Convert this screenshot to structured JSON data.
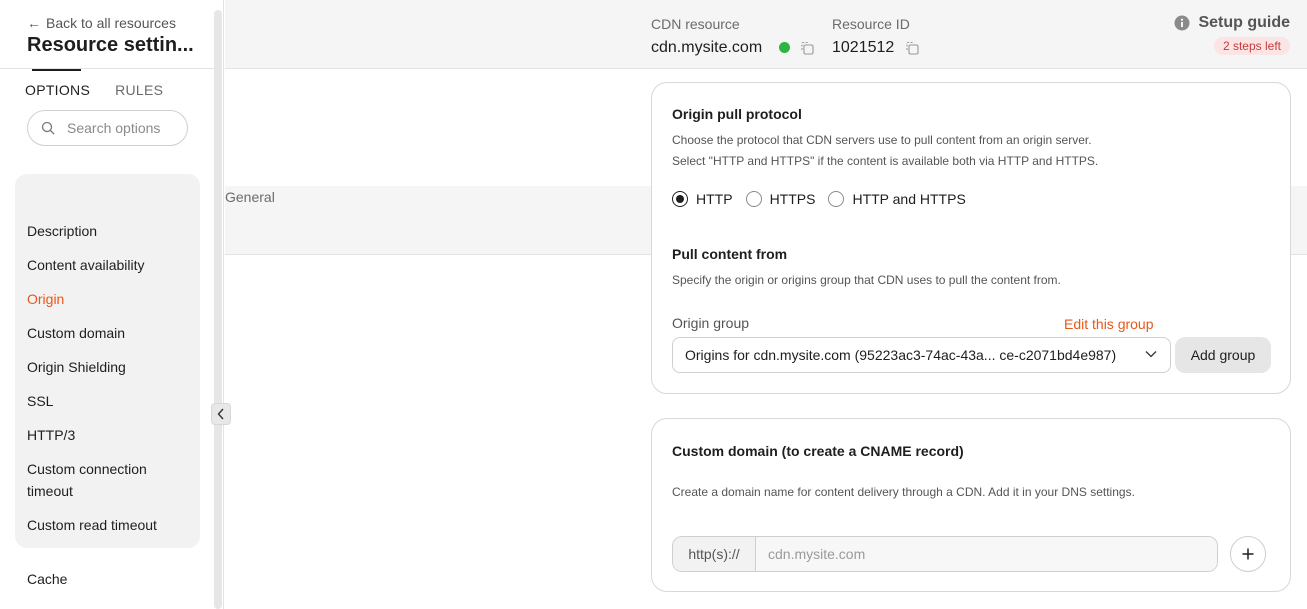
{
  "sidebar": {
    "back_label": "Back to all resources",
    "title": "Resource settin...",
    "tabs": [
      "OPTIONS",
      "RULES"
    ],
    "search_placeholder": "Search options",
    "group_header": "General",
    "items": [
      "Description",
      "Content availability",
      "Origin",
      "Custom domain",
      "Origin Shielding",
      "SSL",
      "HTTP/3",
      "Custom connection timeout",
      "Custom read timeout"
    ],
    "active_item": "Origin",
    "section_after": "Cache"
  },
  "header": {
    "cdn_label": "CDN resource",
    "cdn_value": "cdn.mysite.com",
    "id_label": "Resource ID",
    "id_value": "1021512",
    "guide_label": "Setup guide",
    "steps_badge": "2 steps left"
  },
  "origin_card": {
    "title": "Origin pull protocol",
    "desc1": "Choose the protocol that CDN servers use to pull content from an origin server.",
    "desc2": "Select \"HTTP and HTTPS\" if the content is available both via HTTP and HTTPS.",
    "protocols": [
      "HTTP",
      "HTTPS",
      "HTTP and HTTPS"
    ],
    "selected_protocol": "HTTP",
    "pull_title": "Pull content from",
    "pull_desc": "Specify the origin or origins group that CDN uses to pull the content from.",
    "group_label": "Origin group",
    "edit_link": "Edit this group",
    "group_value": "Origins for cdn.mysite.com (95223ac3-74ac-43a... ce-c2071bd4e987)",
    "add_group": "Add group"
  },
  "domain_card": {
    "title": "Custom domain (to create a CNAME record)",
    "desc": "Create a domain name for content delivery through a CDN. Add it in your DNS settings.",
    "prefix": "http(s)://",
    "placeholder": "cdn.mysite.com"
  },
  "colors": {
    "accent": "#e8571c",
    "status_ok": "#2fb344",
    "badge_bg": "#fde4e4",
    "badge_text": "#c43c3c"
  }
}
